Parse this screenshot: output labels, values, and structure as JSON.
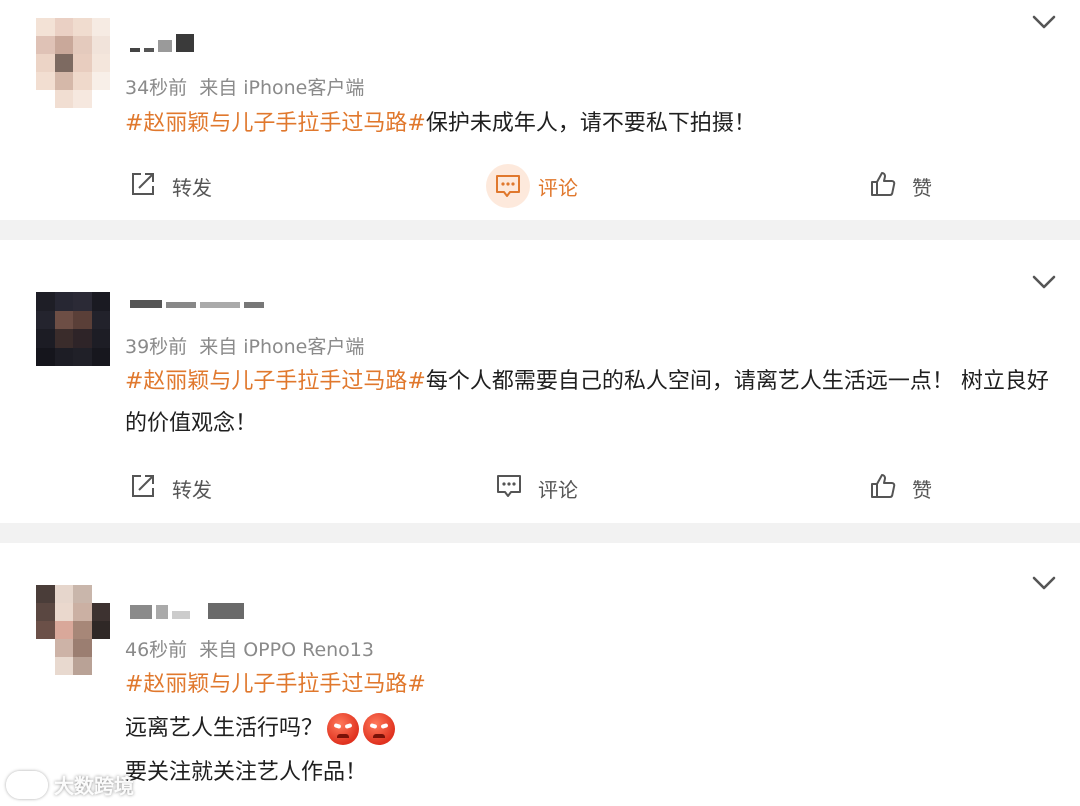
{
  "posts": [
    {
      "time": "34秒前",
      "source": "来自 iPhone客户端",
      "hashtag": "#赵丽颖与儿子手拉手过马路#",
      "text": "保护未成年人，请不要私下拍摄！",
      "lines": [],
      "actions": {
        "repost": "转发",
        "comment": "评论",
        "like": "赞"
      },
      "comment_highlighted": true
    },
    {
      "time": "39秒前",
      "source": "来自 iPhone客户端",
      "hashtag": "#赵丽颖与儿子手拉手过马路#",
      "text": "每个人都需要自己的私人空间，请离艺人生活远一点！ 树立良好的价值观念！",
      "lines": [],
      "actions": {
        "repost": "转发",
        "comment": "评论",
        "like": "赞"
      },
      "comment_highlighted": false
    },
    {
      "time": "46秒前",
      "source": "来自 OPPO Reno13",
      "hashtag": "#赵丽颖与儿子手拉手过马路#",
      "text": "",
      "lines": [
        "远离艺人生活行吗？",
        "要关注就关注艺人作品！"
      ],
      "emoji": "angry-face-emoji",
      "comment_highlighted": false
    }
  ],
  "watermark": {
    "text": "大数跨境",
    "icon": "logo-icon"
  },
  "colors": {
    "tag": "#e0782d",
    "meta": "#8a8a8a",
    "separator": "#f2f2f2",
    "comment_highlight": "#fde9dc"
  },
  "icons": {
    "repost": "share-icon",
    "comment": "comment-icon",
    "like": "thumbs-up-icon",
    "menu": "chevron-down-icon"
  }
}
